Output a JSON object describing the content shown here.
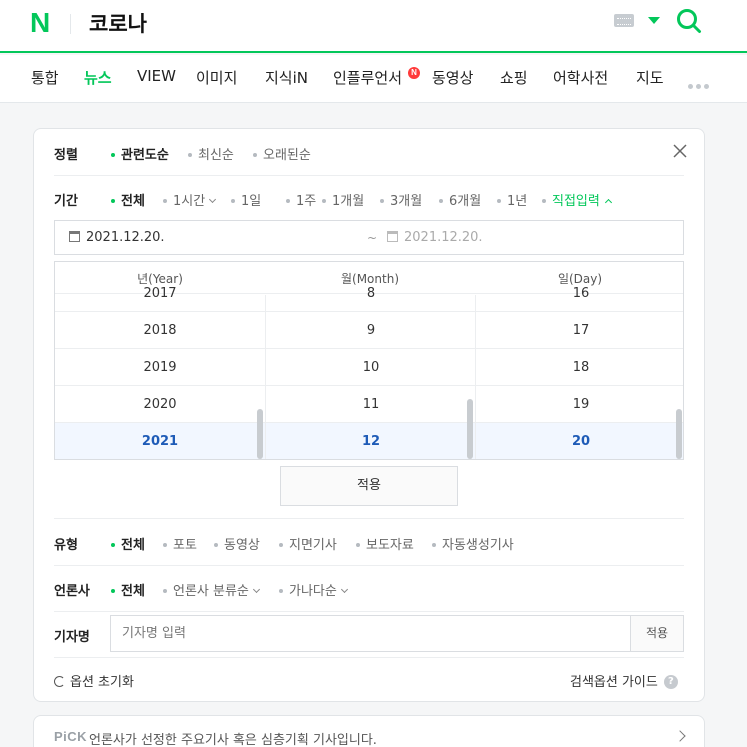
{
  "header": {
    "logo": "N",
    "query": "코로나",
    "brand_color": "#03c75a"
  },
  "tabs": [
    {
      "label": "통합"
    },
    {
      "label": "뉴스",
      "active": true
    },
    {
      "label": "VIEW"
    },
    {
      "label": "이미지"
    },
    {
      "label": "지식iN"
    },
    {
      "label": "인플루언서",
      "badge": "N"
    },
    {
      "label": "동영상"
    },
    {
      "label": "쇼핑"
    },
    {
      "label": "어학사전"
    },
    {
      "label": "지도"
    }
  ],
  "filters": {
    "sort": {
      "label": "정렬",
      "options": [
        "관련도순",
        "최신순",
        "오래된순"
      ],
      "selected": "관련도순"
    },
    "period": {
      "label": "기간",
      "options": [
        "전체",
        "1시간",
        "1일",
        "1주",
        "1개월",
        "3개월",
        "6개월",
        "1년",
        "직접입력"
      ],
      "selected": "전체",
      "date_start": "2021.12.20.",
      "date_sep": "~",
      "date_end": "2021.12.20.",
      "picker": {
        "headers": [
          "년(Year)",
          "월(Month)",
          "일(Day)"
        ],
        "years": [
          "2017",
          "2018",
          "2019",
          "2020",
          "2021"
        ],
        "months": [
          "8",
          "9",
          "10",
          "11",
          "12"
        ],
        "days": [
          "16",
          "17",
          "18",
          "19",
          "20"
        ],
        "selected": {
          "year": "2021",
          "month": "12",
          "day": "20"
        }
      },
      "apply_label": "적용"
    },
    "type": {
      "label": "유형",
      "options": [
        "전체",
        "포토",
        "동영상",
        "지면기사",
        "보도자료",
        "자동생성기사"
      ],
      "selected": "전체"
    },
    "press": {
      "label": "언론사",
      "options": [
        "전체",
        "언론사 분류순",
        "가나다순"
      ],
      "selected": "전체"
    },
    "reporter": {
      "label": "기자명",
      "placeholder": "기자명 입력",
      "button": "적용"
    },
    "reset_label": "옵션 초기화",
    "guide_label": "검색옵션 가이드",
    "help_glyph": "?"
  },
  "pick": {
    "tag": "PiCK",
    "text": "언론사가 선정한 주요기사 혹은 심층기획 기사입니다."
  }
}
